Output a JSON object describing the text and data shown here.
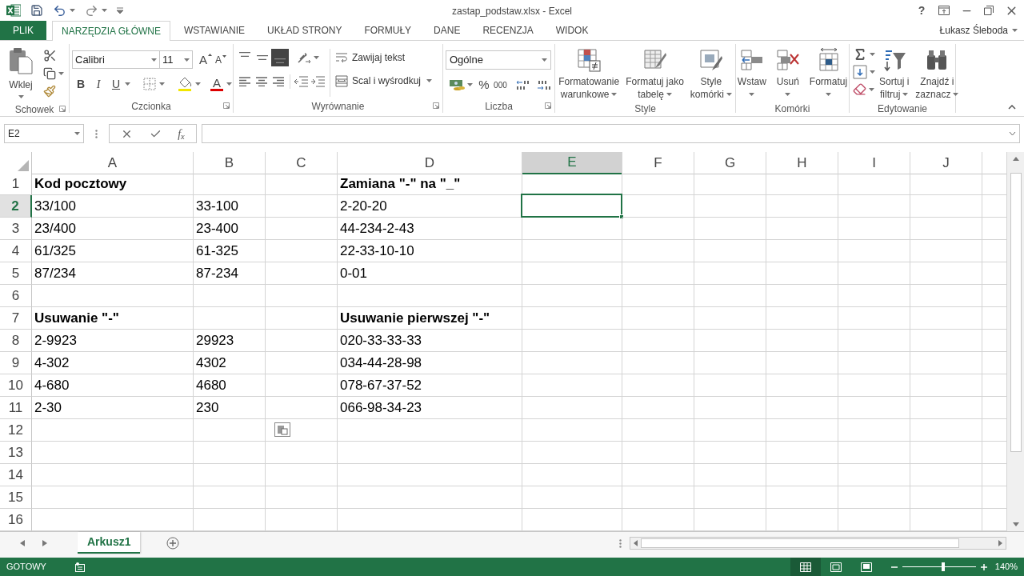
{
  "window": {
    "title": "zastap_podstaw.xlsx - Excel",
    "help": "?"
  },
  "ribbon_tabs": [
    {
      "label": "PLIK",
      "kind": "file",
      "selected": false
    },
    {
      "label": "NARZĘDZIA GŁÓWNE",
      "kind": "tab",
      "selected": true
    },
    {
      "label": "WSTAWIANIE",
      "kind": "tab",
      "selected": false
    },
    {
      "label": "UKŁAD STRONY",
      "kind": "tab",
      "selected": false
    },
    {
      "label": "FORMUŁY",
      "kind": "tab",
      "selected": false
    },
    {
      "label": "DANE",
      "kind": "tab",
      "selected": false
    },
    {
      "label": "RECENZJA",
      "kind": "tab",
      "selected": false
    },
    {
      "label": "WIDOK",
      "kind": "tab",
      "selected": false
    }
  ],
  "user": {
    "name": "Łukasz Śleboda"
  },
  "ribbon": {
    "clipboard": {
      "title": "Schowek",
      "paste": "Wklej"
    },
    "font": {
      "title": "Czcionka",
      "font_name": "Calibri",
      "font_size": "11",
      "grow": "A",
      "shrink": "A",
      "styles": [
        {
          "kind": "bold",
          "label": "B"
        },
        {
          "kind": "italic",
          "label": "I"
        },
        {
          "kind": "underline",
          "label": "U"
        }
      ],
      "font_color": "A"
    },
    "alignment": {
      "title": "Wyrównanie",
      "vertical_align": [
        {
          "kind": "top",
          "selected": false
        },
        {
          "kind": "middle",
          "selected": false
        },
        {
          "kind": "bottom",
          "selected": true
        }
      ],
      "wrap_text": "Zawijaj tekst",
      "merge": "Scal i wyśrodkuj"
    },
    "number": {
      "title": "Liczba",
      "format": "Ogólne",
      "percent": "%",
      "thousands": "000"
    },
    "styles": {
      "title": "Style",
      "buttons": [
        {
          "kind": "conditional",
          "lines": [
            "Formatowanie",
            "warunkowe"
          ]
        },
        {
          "kind": "table",
          "lines": [
            "Formatuj jako",
            "tabelę"
          ]
        },
        {
          "kind": "cell_styles",
          "lines": [
            "Style",
            "komórki"
          ]
        }
      ]
    },
    "cells": {
      "title": "Komórki",
      "buttons": [
        {
          "kind": "insert",
          "lines": [
            "Wstaw"
          ]
        },
        {
          "kind": "delete",
          "lines": [
            "Usuń"
          ]
        },
        {
          "kind": "format",
          "lines": [
            "Formatuj"
          ]
        }
      ]
    },
    "editing": {
      "title": "Edytowanie",
      "buttons": [
        {
          "kind": "sort",
          "lines": [
            "Sortuj i",
            "filtruj"
          ]
        },
        {
          "kind": "find",
          "lines": [
            "Znajdź i",
            "zaznacz"
          ]
        }
      ]
    }
  },
  "formula_bar": {
    "name_box": "E2",
    "function_label": "f$_{x}$"
  },
  "sheet": {
    "columns": [
      {
        "label": "A",
        "selected": false
      },
      {
        "label": "B",
        "selected": false
      },
      {
        "label": "C",
        "selected": false
      },
      {
        "label": "D",
        "selected": false
      },
      {
        "label": "E",
        "selected": true
      },
      {
        "label": "F",
        "selected": false
      },
      {
        "label": "G",
        "selected": false
      },
      {
        "label": "H",
        "selected": false
      },
      {
        "label": "I",
        "selected": false
      },
      {
        "label": "J",
        "selected": false
      }
    ],
    "rows": [
      {
        "number": "1",
        "selected": false,
        "cells": [
          {
            "kind": "text",
            "value": "Kod pocztowy",
            "bold": true
          },
          null,
          null,
          {
            "kind": "text",
            "value": "Zamiana \"-\" na \"_\"",
            "bold": true
          }
        ]
      },
      {
        "number": "2",
        "selected": true,
        "cells": [
          {
            "kind": "text",
            "value": "33/100",
            "bold": false
          },
          {
            "kind": "text",
            "value": "33-100",
            "bold": false
          },
          null,
          {
            "kind": "text",
            "value": "2-20-20",
            "bold": false
          }
        ]
      },
      {
        "number": "3",
        "selected": false,
        "cells": [
          {
            "kind": "text",
            "value": "23/400",
            "bold": false
          },
          {
            "kind": "text",
            "value": "23-400",
            "bold": false
          },
          null,
          {
            "kind": "text",
            "value": "44-234-2-43",
            "bold": false
          }
        ]
      },
      {
        "number": "4",
        "selected": false,
        "cells": [
          {
            "kind": "text",
            "value": "61/325",
            "bold": false
          },
          {
            "kind": "text",
            "value": "61-325",
            "bold": false
          },
          null,
          {
            "kind": "text",
            "value": "22-33-10-10",
            "bold": false
          }
        ]
      },
      {
        "number": "5",
        "selected": false,
        "cells": [
          {
            "kind": "text",
            "value": "87/234",
            "bold": false
          },
          {
            "kind": "text",
            "value": "87-234",
            "bold": false
          },
          null,
          {
            "kind": "text",
            "value": "0-01",
            "bold": false
          }
        ]
      },
      {
        "number": "6",
        "selected": false
      },
      {
        "number": "7",
        "selected": false,
        "cells": [
          {
            "kind": "text",
            "value": "Usuwanie \"-\"",
            "bold": true
          },
          null,
          null,
          {
            "kind": "text",
            "value": "Usuwanie pierwszej \"-\"",
            "bold": true
          }
        ]
      },
      {
        "number": "8",
        "selected": false,
        "cells": [
          {
            "kind": "text",
            "value": "2-9923",
            "bold": false
          },
          {
            "kind": "text",
            "value": "29923",
            "bold": false
          },
          null,
          {
            "kind": "text",
            "value": "020-33-33-33",
            "bold": false
          }
        ]
      },
      {
        "number": "9",
        "selected": false,
        "cells": [
          {
            "kind": "text",
            "value": "4-302",
            "bold": false
          },
          {
            "kind": "text",
            "value": "4302",
            "bold": false
          },
          null,
          {
            "kind": "text",
            "value": "034-44-28-98",
            "bold": false
          }
        ]
      },
      {
        "number": "10",
        "selected": false,
        "cells": [
          {
            "kind": "text",
            "value": "4-680",
            "bold": false
          },
          {
            "kind": "text",
            "value": "4680",
            "bold": false
          },
          null,
          {
            "kind": "text",
            "value": "078-67-37-52",
            "bold": false
          }
        ]
      },
      {
        "number": "11",
        "selected": false,
        "cells": [
          {
            "kind": "text",
            "value": "2-30",
            "bold": false
          },
          {
            "kind": "text",
            "value": "230",
            "bold": false
          },
          null,
          {
            "kind": "text",
            "value": "066-98-34-23",
            "bold": false
          }
        ]
      },
      {
        "number": "12",
        "selected": false,
        "cells": [
          null,
          null,
          {
            "kind": "paste_options"
          }
        ]
      },
      {
        "number": "13",
        "selected": false
      },
      {
        "number": "14",
        "selected": false
      },
      {
        "number": "15",
        "selected": false
      },
      {
        "number": "16",
        "selected": false
      }
    ]
  },
  "sheet_tabs": [
    {
      "label": "Arkusz1",
      "selected": true
    }
  ],
  "status_bar": {
    "status": "GOTOWY",
    "views": [
      {
        "kind": "normal",
        "selected": true
      },
      {
        "kind": "page_layout",
        "selected": false
      },
      {
        "kind": "page_break",
        "selected": false
      }
    ],
    "zoom": {
      "level": 0.56,
      "reading": "140%"
    }
  }
}
